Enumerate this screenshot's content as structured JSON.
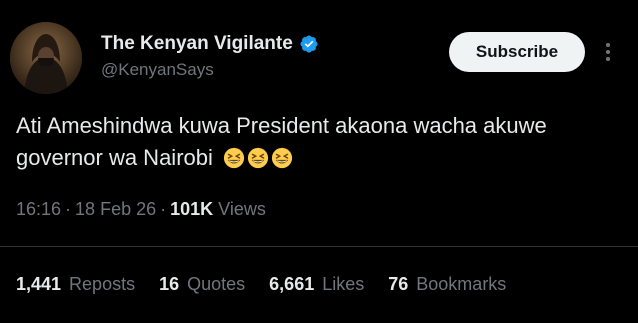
{
  "author": {
    "display_name": "The Kenyan Vigilante",
    "handle": "@KenyanSays",
    "verified": true
  },
  "actions": {
    "subscribe_label": "Subscribe",
    "more_icon": "more-vertical-icon"
  },
  "tweet": {
    "text": "Ati Ameshindwa kuwa President akaona wacha akuwe governor wa Nairobi",
    "emoji": [
      "grinning-squinting-face",
      "grinning-squinting-face",
      "grinning-squinting-face"
    ]
  },
  "meta": {
    "time": "16:16",
    "date": "18 Feb 26",
    "views_count": "101K",
    "views_label": "Views",
    "separator": "·"
  },
  "stats": [
    {
      "count": "1,441",
      "label": "Reposts"
    },
    {
      "count": "16",
      "label": "Quotes"
    },
    {
      "count": "6,661",
      "label": "Likes"
    },
    {
      "count": "76",
      "label": "Bookmarks"
    }
  ],
  "colors": {
    "background": "#000000",
    "primary_text": "#e7e9ea",
    "secondary_text": "#71767b",
    "verified_blue": "#1d9bf0",
    "divider": "#2f3336"
  }
}
